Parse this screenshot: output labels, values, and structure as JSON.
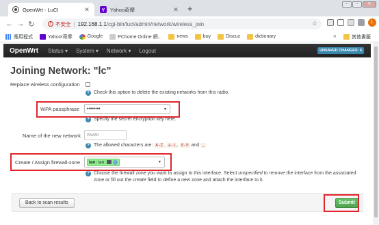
{
  "browser": {
    "tabs": [
      {
        "title": "OpenWrt - LuCI",
        "active": true
      },
      {
        "title": "Yahoo奇摩",
        "active": false
      }
    ],
    "new_tab": "+",
    "insecure_label": "不安全",
    "url_host": "192.168.1.1",
    "url_path": "/cgi-bin/luci/admin/network/wireless_join",
    "avatar_letter": "L",
    "bookmarks": [
      {
        "label": "應用程式",
        "icon": "apps-grid-icon"
      },
      {
        "label": "Yahoo!奇摩",
        "icon": "yahoo-icon"
      },
      {
        "label": "Google",
        "icon": "google-icon"
      },
      {
        "label": "PChome Online 網...",
        "icon": "pchome-icon"
      },
      {
        "label": "news",
        "icon": "folder-icon"
      },
      {
        "label": "buy",
        "icon": "folder-icon"
      },
      {
        "label": "Discuz",
        "icon": "folder-icon"
      },
      {
        "label": "dictionary",
        "icon": "folder-icon"
      }
    ],
    "bookmarks_more": "»",
    "other_bookmarks": "其他書籤"
  },
  "luci": {
    "brand": "OpenWrt",
    "menu": [
      "Status ▾",
      "System ▾",
      "Network ▾",
      "Logout"
    ],
    "unsaved": "UNSAVED CHANGES: 6",
    "page_title": "Joining Network: \"lc\"",
    "replace_label": "Replace wireless configuration",
    "replace_help": "Check this option to delete the existing networks from this radio.",
    "wpa_label": "WPA passphrase",
    "wpa_value": "••••••••",
    "wpa_help": "Specify the secret encryption key here.",
    "name_label": "Name of the new network",
    "name_value": "wwan",
    "name_help_prefix": "The allowed characters are:",
    "name_help_codes": [
      "A-Z",
      "a-z",
      "0-9"
    ],
    "name_help_and": "and",
    "name_help_last": "_",
    "fw_label": "Create / Assign firewall-zone",
    "fw_zone": "lan:",
    "fw_zone_iface": "lan:",
    "fw_help_1": "Choose the firewall zone you want to assign to this interface. Select",
    "fw_help_unspecified": "unspecified",
    "fw_help_2": "to remove the interface from the associated zone or fill out the",
    "fw_help_create": "create",
    "fw_help_3": "field to define a new zone and attach the interface to it.",
    "back_button": "Back to scan results",
    "submit_button": "Submit"
  },
  "colors": {
    "highlight": "#e0242a",
    "submit": "#5bb75b",
    "header": "#252525",
    "help_icon": "#3a87ad",
    "zone": "#90f090"
  }
}
